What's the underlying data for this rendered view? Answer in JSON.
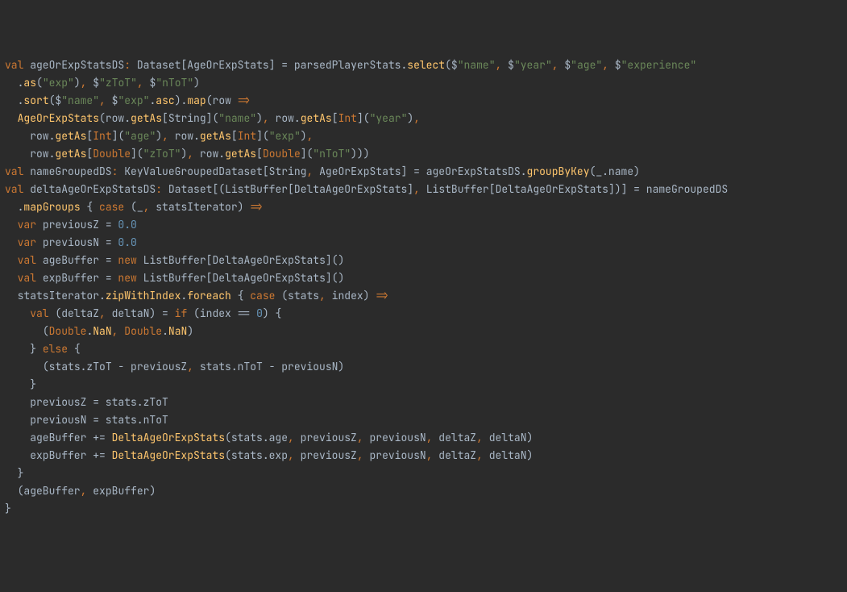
{
  "code": {
    "lines": [
      {
        "indent": 0,
        "tokens": [
          [
            "kw",
            "val"
          ],
          [
            "op",
            " ageOrExpStatsDS"
          ],
          [
            "punc",
            ":"
          ],
          [
            "op",
            " "
          ],
          [
            "type",
            "Dataset"
          ],
          [
            "op",
            "["
          ],
          [
            "type",
            "AgeOrExpStats"
          ],
          [
            "op",
            "] = parsedPlayerStats."
          ],
          [
            "fn",
            "select"
          ],
          [
            "op",
            "($"
          ],
          [
            "str",
            "\"name\""
          ],
          [
            "punc",
            ","
          ],
          [
            "op",
            " $"
          ],
          [
            "str",
            "\"year\""
          ],
          [
            "punc",
            ","
          ],
          [
            "op",
            " $"
          ],
          [
            "str",
            "\"age\""
          ],
          [
            "punc",
            ","
          ],
          [
            "op",
            " $"
          ],
          [
            "str",
            "\"experience\""
          ]
        ]
      },
      {
        "indent": 1,
        "tokens": [
          [
            "op",
            "."
          ],
          [
            "fn",
            "as"
          ],
          [
            "op",
            "("
          ],
          [
            "str",
            "\"exp\""
          ],
          [
            "op",
            ")"
          ],
          [
            "punc",
            ","
          ],
          [
            "op",
            " $"
          ],
          [
            "str",
            "\"zToT\""
          ],
          [
            "punc",
            ","
          ],
          [
            "op",
            " $"
          ],
          [
            "str",
            "\"nToT\""
          ],
          [
            "op",
            ")"
          ]
        ]
      },
      {
        "indent": 1,
        "tokens": [
          [
            "op",
            "."
          ],
          [
            "fn",
            "sort"
          ],
          [
            "op",
            "($"
          ],
          [
            "str",
            "\"name\""
          ],
          [
            "punc",
            ","
          ],
          [
            "op",
            " $"
          ],
          [
            "str",
            "\"exp\""
          ],
          [
            "op",
            "."
          ],
          [
            "fn",
            "asc"
          ],
          [
            "op",
            ")."
          ],
          [
            "fn",
            "map"
          ],
          [
            "op",
            "(row "
          ],
          [
            "kw",
            "=>"
          ]
        ]
      },
      {
        "indent": 1,
        "tokens": [
          [
            "fn",
            "AgeOrExpStats"
          ],
          [
            "op",
            "(row."
          ],
          [
            "fn",
            "getAs"
          ],
          [
            "op",
            "["
          ],
          [
            "type",
            "String"
          ],
          [
            "op",
            "]("
          ],
          [
            "str",
            "\"name\""
          ],
          [
            "op",
            ")"
          ],
          [
            "punc",
            ","
          ],
          [
            "op",
            " row."
          ],
          [
            "fn",
            "getAs"
          ],
          [
            "op",
            "["
          ],
          [
            "kw",
            "Int"
          ],
          [
            "op",
            "]("
          ],
          [
            "str",
            "\"year\""
          ],
          [
            "op",
            ")"
          ],
          [
            "punc",
            ","
          ]
        ]
      },
      {
        "indent": 2,
        "tokens": [
          [
            "op",
            "row."
          ],
          [
            "fn",
            "getAs"
          ],
          [
            "op",
            "["
          ],
          [
            "kw",
            "Int"
          ],
          [
            "op",
            "]("
          ],
          [
            "str",
            "\"age\""
          ],
          [
            "op",
            ")"
          ],
          [
            "punc",
            ","
          ],
          [
            "op",
            " row."
          ],
          [
            "fn",
            "getAs"
          ],
          [
            "op",
            "["
          ],
          [
            "kw",
            "Int"
          ],
          [
            "op",
            "]("
          ],
          [
            "str",
            "\"exp\""
          ],
          [
            "op",
            ")"
          ],
          [
            "punc",
            ","
          ]
        ]
      },
      {
        "indent": 2,
        "tokens": [
          [
            "op",
            "row."
          ],
          [
            "fn",
            "getAs"
          ],
          [
            "op",
            "["
          ],
          [
            "kw",
            "Double"
          ],
          [
            "op",
            "]("
          ],
          [
            "str",
            "\"zToT\""
          ],
          [
            "op",
            ")"
          ],
          [
            "punc",
            ","
          ],
          [
            "op",
            " row."
          ],
          [
            "fn",
            "getAs"
          ],
          [
            "op",
            "["
          ],
          [
            "kw",
            "Double"
          ],
          [
            "op",
            "]("
          ],
          [
            "str",
            "\"nToT\""
          ],
          [
            "op",
            ")))"
          ]
        ]
      },
      {
        "indent": 0,
        "tokens": [
          [
            "op",
            ""
          ]
        ]
      },
      {
        "indent": 0,
        "tokens": [
          [
            "kw",
            "val"
          ],
          [
            "op",
            " nameGroupedDS"
          ],
          [
            "punc",
            ":"
          ],
          [
            "op",
            " "
          ],
          [
            "type",
            "KeyValueGroupedDataset"
          ],
          [
            "op",
            "["
          ],
          [
            "type",
            "String"
          ],
          [
            "punc",
            ","
          ],
          [
            "op",
            " "
          ],
          [
            "type",
            "AgeOrExpStats"
          ],
          [
            "op",
            "] = ageOrExpStatsDS."
          ],
          [
            "fn",
            "groupByKey"
          ],
          [
            "op",
            "(_.name)"
          ]
        ]
      },
      {
        "indent": 0,
        "tokens": [
          [
            "op",
            ""
          ]
        ]
      },
      {
        "indent": 0,
        "tokens": [
          [
            "kw",
            "val"
          ],
          [
            "op",
            " deltaAgeOrExpStatsDS"
          ],
          [
            "punc",
            ":"
          ],
          [
            "op",
            " "
          ],
          [
            "type",
            "Dataset"
          ],
          [
            "op",
            "[("
          ],
          [
            "type",
            "ListBuffer"
          ],
          [
            "op",
            "["
          ],
          [
            "type",
            "DeltaAgeOrExpStats"
          ],
          [
            "op",
            "]"
          ],
          [
            "punc",
            ","
          ],
          [
            "op",
            " "
          ],
          [
            "type",
            "ListBuffer"
          ],
          [
            "op",
            "["
          ],
          [
            "type",
            "DeltaAgeOrExpStats"
          ],
          [
            "op",
            "])] = nameGroupedDS"
          ]
        ]
      },
      {
        "indent": 1,
        "tokens": [
          [
            "op",
            "."
          ],
          [
            "fn",
            "mapGroups"
          ],
          [
            "op",
            " { "
          ],
          [
            "kw",
            "case"
          ],
          [
            "op",
            " (_"
          ],
          [
            "punc",
            ","
          ],
          [
            "op",
            " statsIterator) "
          ],
          [
            "kw",
            "=>"
          ]
        ]
      },
      {
        "indent": 1,
        "tokens": [
          [
            "kw",
            "var"
          ],
          [
            "op",
            " previousZ = "
          ],
          [
            "num",
            "0.0"
          ]
        ]
      },
      {
        "indent": 1,
        "tokens": [
          [
            "kw",
            "var"
          ],
          [
            "op",
            " previousN = "
          ],
          [
            "num",
            "0.0"
          ]
        ]
      },
      {
        "indent": 1,
        "tokens": [
          [
            "kw",
            "val"
          ],
          [
            "op",
            " ageBuffer = "
          ],
          [
            "kw",
            "new"
          ],
          [
            "op",
            " "
          ],
          [
            "type",
            "ListBuffer"
          ],
          [
            "op",
            "["
          ],
          [
            "type",
            "DeltaAgeOrExpStats"
          ],
          [
            "op",
            "]()"
          ]
        ]
      },
      {
        "indent": 1,
        "tokens": [
          [
            "kw",
            "val"
          ],
          [
            "op",
            " expBuffer = "
          ],
          [
            "kw",
            "new"
          ],
          [
            "op",
            " "
          ],
          [
            "type",
            "ListBuffer"
          ],
          [
            "op",
            "["
          ],
          [
            "type",
            "DeltaAgeOrExpStats"
          ],
          [
            "op",
            "]()"
          ]
        ]
      },
      {
        "indent": 1,
        "tokens": [
          [
            "op",
            "statsIterator."
          ],
          [
            "fn",
            "zipWithIndex"
          ],
          [
            "op",
            "."
          ],
          [
            "fn",
            "foreach"
          ],
          [
            "op",
            " { "
          ],
          [
            "kw",
            "case"
          ],
          [
            "op",
            " (stats"
          ],
          [
            "punc",
            ","
          ],
          [
            "op",
            " index) "
          ],
          [
            "kw",
            "=>"
          ]
        ]
      },
      {
        "indent": 2,
        "tokens": [
          [
            "kw",
            "val"
          ],
          [
            "op",
            " (deltaZ"
          ],
          [
            "punc",
            ","
          ],
          [
            "op",
            " deltaN) = "
          ],
          [
            "kw",
            "if"
          ],
          [
            "op",
            " (index == "
          ],
          [
            "num",
            "0"
          ],
          [
            "op",
            ") {"
          ]
        ]
      },
      {
        "indent": 3,
        "tokens": [
          [
            "op",
            "("
          ],
          [
            "kw",
            "Double"
          ],
          [
            "op",
            "."
          ],
          [
            "fn",
            "NaN"
          ],
          [
            "punc",
            ","
          ],
          [
            "op",
            " "
          ],
          [
            "kw",
            "Double"
          ],
          [
            "op",
            "."
          ],
          [
            "fn",
            "NaN"
          ],
          [
            "op",
            ")"
          ]
        ]
      },
      {
        "indent": 2,
        "tokens": [
          [
            "op",
            "} "
          ],
          [
            "kw",
            "else"
          ],
          [
            "op",
            " {"
          ]
        ]
      },
      {
        "indent": 3,
        "tokens": [
          [
            "op",
            "(stats.zToT - previousZ"
          ],
          [
            "punc",
            ","
          ],
          [
            "op",
            " stats.nToT - previousN)"
          ]
        ]
      },
      {
        "indent": 2,
        "tokens": [
          [
            "op",
            "}"
          ]
        ]
      },
      {
        "indent": 2,
        "tokens": [
          [
            "op",
            "previousZ = stats.zToT"
          ]
        ]
      },
      {
        "indent": 2,
        "tokens": [
          [
            "op",
            "previousN = stats.nToT"
          ]
        ]
      },
      {
        "indent": 2,
        "tokens": [
          [
            "op",
            "ageBuffer += "
          ],
          [
            "fn",
            "DeltaAgeOrExpStats"
          ],
          [
            "op",
            "(stats.age"
          ],
          [
            "punc",
            ","
          ],
          [
            "op",
            " previousZ"
          ],
          [
            "punc",
            ","
          ],
          [
            "op",
            " previousN"
          ],
          [
            "punc",
            ","
          ],
          [
            "op",
            " deltaZ"
          ],
          [
            "punc",
            ","
          ],
          [
            "op",
            " deltaN)"
          ]
        ]
      },
      {
        "indent": 2,
        "tokens": [
          [
            "op",
            "expBuffer += "
          ],
          [
            "fn",
            "DeltaAgeOrExpStats"
          ],
          [
            "op",
            "(stats.exp"
          ],
          [
            "punc",
            ","
          ],
          [
            "op",
            " previousZ"
          ],
          [
            "punc",
            ","
          ],
          [
            "op",
            " previousN"
          ],
          [
            "punc",
            ","
          ],
          [
            "op",
            " deltaZ"
          ],
          [
            "punc",
            ","
          ],
          [
            "op",
            " deltaN)"
          ]
        ]
      },
      {
        "indent": 1,
        "tokens": [
          [
            "op",
            "}"
          ]
        ]
      },
      {
        "indent": 1,
        "tokens": [
          [
            "op",
            "(ageBuffer"
          ],
          [
            "punc",
            ","
          ],
          [
            "op",
            " expBuffer)"
          ]
        ]
      },
      {
        "indent": 0,
        "tokens": [
          [
            "op",
            "}"
          ]
        ]
      }
    ]
  }
}
